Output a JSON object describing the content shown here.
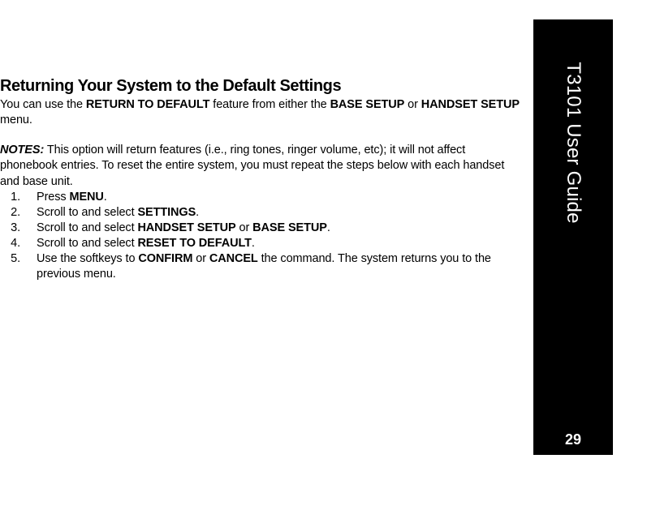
{
  "sidebar": {
    "title": "T3101 User Guide",
    "page_number": "29"
  },
  "heading": "Returning Your System to the Default Settings",
  "intro": {
    "t1": "You can use the ",
    "b1": "RETURN TO DEFAULT",
    "t2": " feature from either the ",
    "b2": "BASE SETUP",
    "t3": " or ",
    "b3": "HANDSET SETUP",
    "t4": " menu."
  },
  "notes": {
    "label": "NOTES:",
    "body": " This option will return features (i.e., ring tones, ringer volume, etc); it will not affect phonebook entries. To reset the entire system, you must repeat the steps below with each handset and base unit."
  },
  "steps": {
    "s1": {
      "t1": "Press ",
      "b1": "MENU",
      "t2": "."
    },
    "s2": {
      "t1": "Scroll to and select ",
      "b1": "SETTINGS",
      "t2": "."
    },
    "s3": {
      "t1": "Scroll to and select ",
      "b1": "HANDSET SETUP",
      "t2": " or ",
      "b2": "BASE SETUP",
      "t3": "."
    },
    "s4": {
      "t1": "Scroll to and select ",
      "b1": "RESET TO DEFAULT",
      "t2": "."
    },
    "s5": {
      "t1": "Use the softkeys to ",
      "b1": "CONFIRM",
      "t2": " or ",
      "b2": "CANCEL",
      "t3": " the command. The system returns you to the previous menu."
    }
  }
}
